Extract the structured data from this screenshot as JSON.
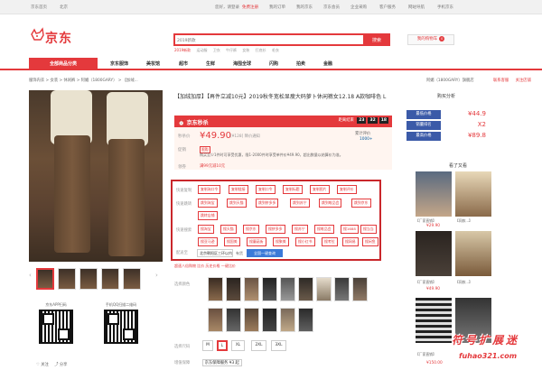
{
  "topbar": {
    "home": "京东首页",
    "location": "北京",
    "greeting": "您好，请登录",
    "register": "免费注册",
    "links": [
      "我的订单",
      "我的京东",
      "京东会员",
      "企业采购",
      "客户服务",
      "网站导航",
      "手机京东"
    ]
  },
  "header": {
    "logo_text": "京东",
    "search_placeholder": "2019新款",
    "search_button": "搜索",
    "hotwords": [
      "2019新款",
      "运动服",
      "卫衣",
      "牛仔裤",
      "女装",
      "打底衫",
      "毛衣"
    ],
    "cart_label": "我的购物车",
    "cart_count": "0"
  },
  "nav": {
    "all_categories": "全部商品分类",
    "items": [
      "京东服饰",
      "美妆馆",
      "超市",
      "生鲜",
      "海囤全球",
      "闪购",
      "拍卖",
      "金融"
    ]
  },
  "breadcrumb": {
    "path": "服饰内衣  >  女装  >  休闲裤  >  阿媚（1800GARY）  >  【加绒...",
    "store": "阿媚（1800GARY）旗舰店",
    "contact": "联系客服",
    "follow": "关注店铺"
  },
  "product": {
    "title": "【加绒加厚】【再件立减10元】2019秋冬宽松显瘦大码萝卜休闲裤女12.18 A款咖啡色 L",
    "flash_name": "京东秒杀",
    "countdown_label": "距离结束",
    "countdown": [
      "23",
      "32",
      "18"
    ],
    "price_label": "秒杀价",
    "price": "¥49.90",
    "jd_price": "[¥128] 降价通知",
    "reviews_label": "累计评价",
    "reviews": "1000+",
    "promo_label": "促销",
    "promo_tag": "限购",
    "promo_text": "购买至少1件时可享受优惠，限1-2000件时享受单件价¥49.90，超出数量以结算价为准。",
    "coupon_label": "领券",
    "coupon": "满99元减10元"
  },
  "panel": {
    "rows": [
      {
        "label": "快速复制",
        "chips": [
          "复制淘口令",
          "复制链接",
          "复制口令",
          "复制标题",
          "复制图片",
          "复制评价"
        ]
      },
      {
        "label": "快速跳转",
        "chips": [
          "跳到淘宝",
          "跳到天猫",
          "跳到拼多多",
          "跳到苏宁",
          "跳到唯品会",
          "跳到京东"
        ]
      },
      {
        "label": "",
        "chips": [
          "跳转店铺"
        ]
      },
      {
        "label": "快速搜索",
        "chips": [
          "搜淘宝",
          "搜天猫",
          "搜京东",
          "搜拼多多",
          "搜苏宁",
          "搜唯品会",
          "搜1688",
          "搜当当"
        ]
      },
      {
        "label": "",
        "chips": [
          "搜亚马逊",
          "搜国美",
          "搜蘑菇街",
          "搜聚美",
          "搜小红书",
          "搜考拉",
          "搜网易",
          "搜闲鱼"
        ]
      }
    ],
    "address_label": "配送至",
    "address": "北京朝阳区三环以内",
    "stock": "有货",
    "address_button": "全国一键查询"
  },
  "below_panel": "超速八倍购物  比价  历史价格  一键比价",
  "options": {
    "color_label": "选择颜色",
    "size_label": "选择尺码",
    "sizes": [
      "M",
      "L",
      "XL",
      "2XL",
      "3XL"
    ],
    "selected_size": "L",
    "delivery_label": "增值保障",
    "delivery": "京东保障服务 ¥3 起"
  },
  "qr": {
    "app_label": "京东APP扫码",
    "wx_label": "手机QQ扫描二维码",
    "follow": "关注",
    "share": "分享"
  },
  "price_compare": {
    "title": "购买分析",
    "rows": [
      {
        "label": "最低价格",
        "value": "¥44.9"
      },
      {
        "label": "销量排名",
        "value": "X2"
      },
      {
        "label": "最高价格",
        "value": "¥89.8"
      }
    ]
  },
  "recommend": {
    "title": "看了又看",
    "items": [
      {
        "caption": "【厂家直销】",
        "price": "¥29.90"
      },
      {
        "caption": "【同款...】",
        "price": ""
      },
      {
        "caption": "【厂家直销】",
        "price": "¥49.90"
      },
      {
        "caption": "【同款...】",
        "price": ""
      },
      {
        "caption": "【厂家直销】",
        "price": "¥150.00"
      }
    ]
  },
  "watermark": {
    "big": "符号扩展迷",
    "small": "fuhao321.com"
  },
  "colors": {
    "brand": "#e4393c",
    "panel_border": "#c9272b",
    "compare_label": "#3b5aa8"
  }
}
